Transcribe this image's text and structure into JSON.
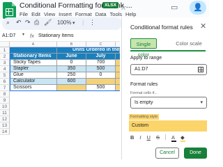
{
  "header": {
    "title": "Conditional Formatting for Blank ...",
    "badge": "XLSX",
    "menu": [
      "File",
      "Edit",
      "View",
      "Insert",
      "Format",
      "Data",
      "Tools",
      "Help"
    ]
  },
  "toolbar": {
    "zoom": "100%"
  },
  "formula_bar": {
    "name_box": "A1:D7",
    "fx_label": "fx",
    "formula": "Stationary Items"
  },
  "sheet": {
    "columns": [
      "A",
      "B",
      "C",
      "D"
    ],
    "rows": [
      "1",
      "2",
      "3",
      "4",
      "5",
      "6",
      "7",
      "8",
      "9",
      "10",
      "11",
      "12",
      "13",
      "14"
    ],
    "header_row1": [
      "",
      "Units Ordered in the M"
    ],
    "header_row2": [
      "Stationary Items",
      "June",
      "July",
      ""
    ],
    "data": [
      [
        "Sticky Tapes",
        "0",
        "700",
        ""
      ],
      [
        "Stapler",
        "350",
        "500",
        ""
      ],
      [
        "Glue",
        "250",
        "0",
        ""
      ],
      [
        "Calculator",
        "600",
        "",
        ""
      ],
      [
        "Scissors",
        "",
        "500",
        ""
      ]
    ],
    "colors": {
      "header": "#1a7fbd",
      "zebra": "#c9e4f2",
      "highlight": "#f3d27d"
    }
  },
  "panel": {
    "title": "Conditional format rules",
    "tabs": [
      "Single color",
      "Color scale"
    ],
    "apply_label": "Apply to range",
    "range_value": "A1:D7",
    "rules_label": "Format rules",
    "cells_if_label": "Format cells if...",
    "condition": "Is empty",
    "style_label": "Formatting style",
    "style_preview": "Custom",
    "cancel": "Cancel",
    "done": "Done"
  }
}
